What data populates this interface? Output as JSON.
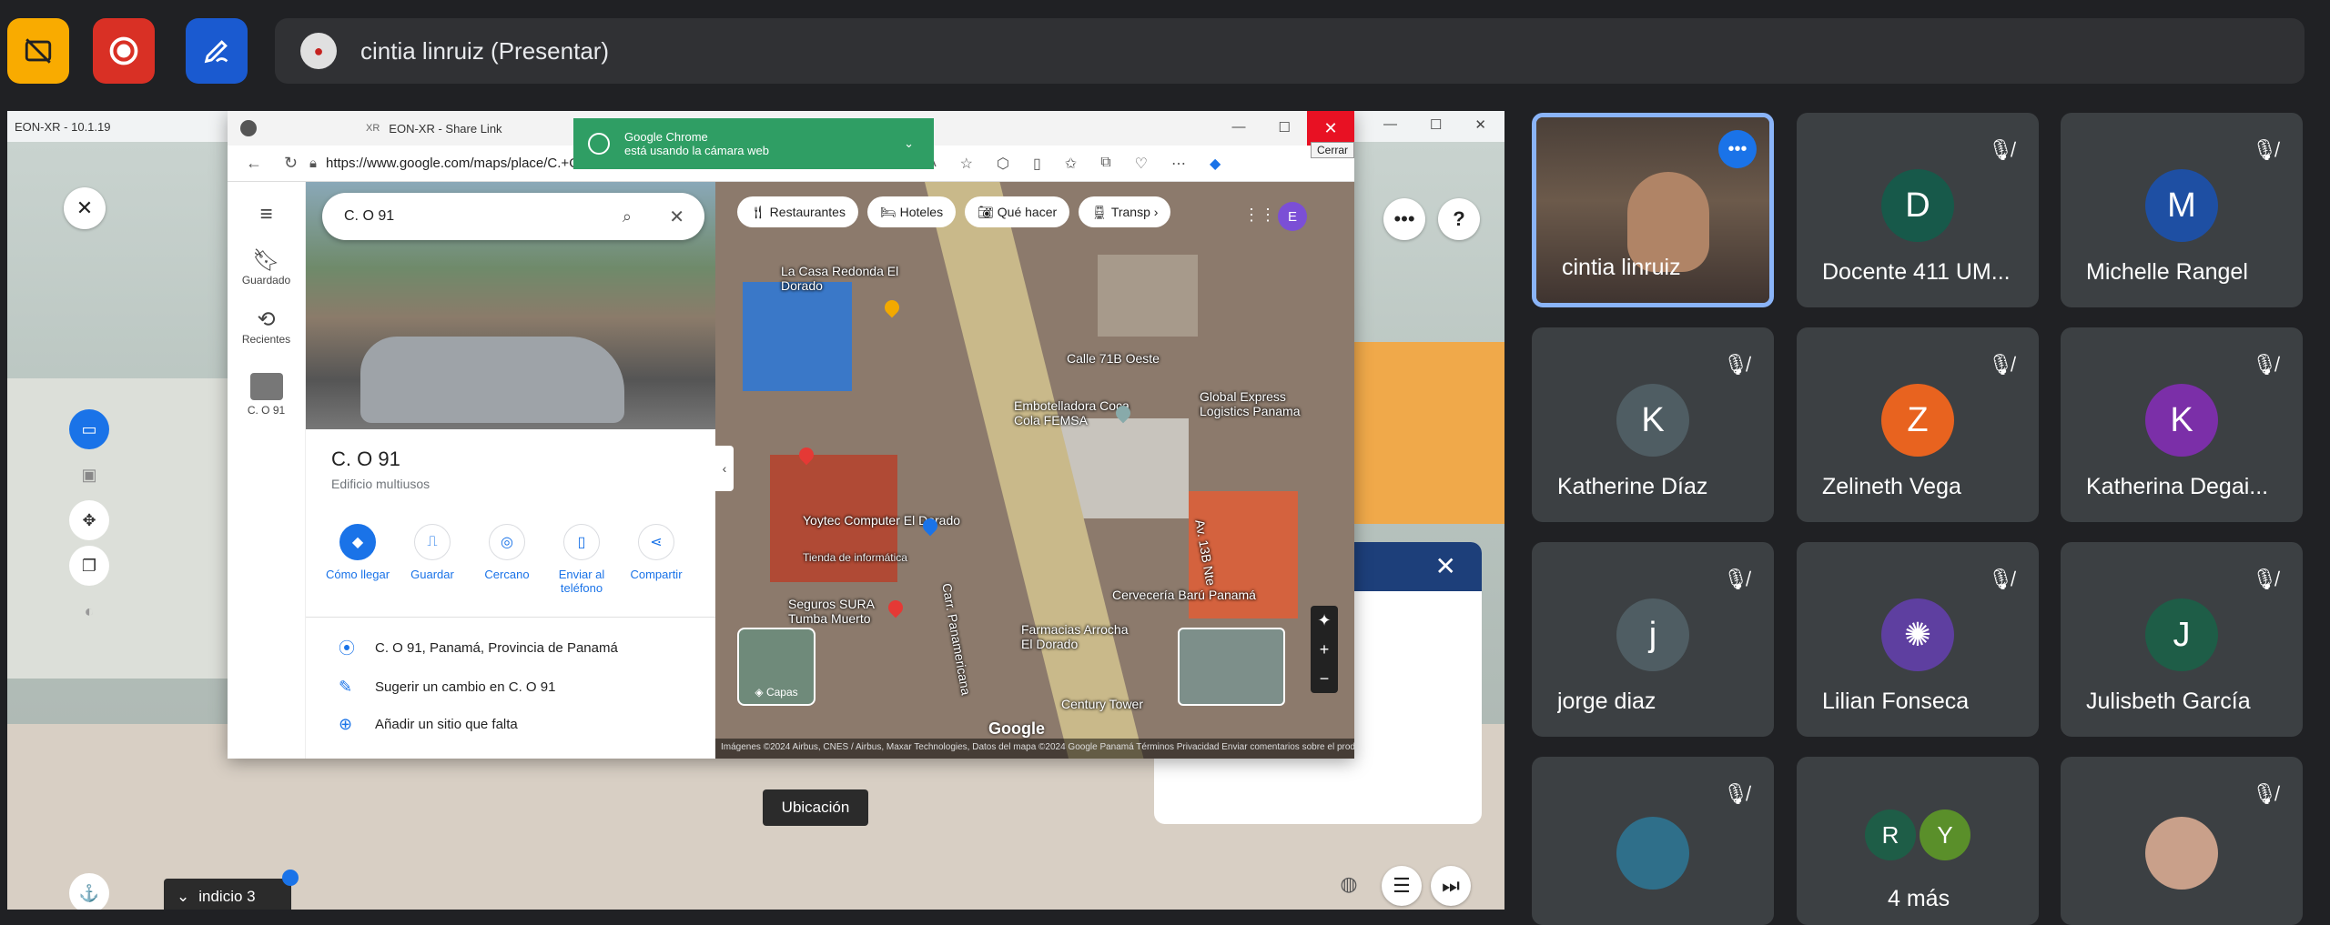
{
  "top_toolbar": {
    "buttons": [
      {
        "icon": "no-captions-icon",
        "color": "#f9ab00"
      },
      {
        "icon": "record-icon",
        "color": "#d93025"
      },
      {
        "icon": "annotate-pen-icon",
        "color": "#1a5ad0"
      }
    ],
    "presenter_label": "cintia linruiz (Presentar)"
  },
  "shared_screen": {
    "eon_window_title": "EON-XR - 10.1.19",
    "browser": {
      "tab_title": "EON-XR - Share Link",
      "url": "https://www.google.com/maps/place/C.+O+91,+Panamá,+Provincia+de+Panamá...",
      "close_tooltip": "Cerrar",
      "notification": {
        "line1": "Google Chrome",
        "line2": "está usando la cámara web"
      }
    },
    "maps": {
      "rail": [
        {
          "icon": "menu-icon",
          "label": ""
        },
        {
          "icon": "bookmark-icon",
          "label": "Guardado"
        },
        {
          "icon": "history-icon",
          "label": "Recientes"
        },
        {
          "icon": "place-thumb-icon",
          "label": "C. O 91"
        }
      ],
      "search_value": "C. O 91",
      "place_title": "C. O 91",
      "place_subtitle": "Edificio multiusos",
      "actions": [
        "Cómo llegar",
        "Guardar",
        "Cercano",
        "Enviar al teléfono",
        "Compartir"
      ],
      "info_rows": [
        "C. O 91, Panamá, Provincia de Panamá",
        "Sugerir un cambio en C. O 91",
        "Añadir un sitio que falta"
      ],
      "chips": [
        "Restaurantes",
        "Hoteles",
        "Qué hacer",
        "Transp"
      ],
      "account_initial": "E",
      "map_labels": [
        "La Casa Redonda El Dorado",
        "Calle 71B Oeste",
        "Embotelladora Coca Cola FEMSA",
        "Global Express Logistics Panama",
        "Yoytec Computer El Dorado",
        "Tienda de informática",
        "Seguros SURA Tumba Muerto",
        "Farmacias Arrocha El Dorado",
        "Cervecería Barú Panamá",
        "Century Tower",
        "Carr. Panamericana",
        "Av. 13B Nte"
      ],
      "layers_label": "Capas",
      "attribution": "Imágenes ©2024 Airbus, CNES / Airbus, Maxar Technologies, Datos del mapa ©2024 Google   Panamá   Términos   Privacidad   Enviar comentarios sobre el producto   100 m",
      "google_logo": "Google"
    },
    "eon": {
      "indicio_label": "indicio 3",
      "ubicacion_label": "Ubicación"
    }
  },
  "participants": [
    {
      "name": "cintia linruiz",
      "initial": "",
      "color": "",
      "self": true
    },
    {
      "name": "Docente 411 UM...",
      "initial": "D",
      "color": "#17594a",
      "muted": true
    },
    {
      "name": "Michelle Rangel",
      "initial": "M",
      "color": "#1e4fa3",
      "muted": true
    },
    {
      "name": "Katherine Díaz",
      "initial": "K",
      "color": "#4f5d63",
      "muted": true
    },
    {
      "name": "Zelineth Vega",
      "initial": "Z",
      "color": "#e8631f",
      "muted": true
    },
    {
      "name": "Katherina Degai...",
      "initial": "K",
      "color": "#7b2fa8",
      "muted": true
    },
    {
      "name": "jorge diaz",
      "initial": "j",
      "color": "#4f5d63",
      "muted": true
    },
    {
      "name": "Lilian Fonseca",
      "initial": "",
      "color": "#5e3fa0",
      "muted": true
    },
    {
      "name": "Julisbeth García",
      "initial": "J",
      "color": "#1e5d47",
      "muted": true
    },
    {
      "name": "",
      "initial": "",
      "color": "#2f6f8a",
      "muted": true
    },
    {
      "name": "4 más",
      "initials": [
        "R",
        "Y"
      ],
      "colors": [
        "#1e5d47",
        "#5a8f2a"
      ],
      "muted": false
    },
    {
      "name": "",
      "initial": "",
      "color": "#c9a08a",
      "muted": true
    }
  ]
}
